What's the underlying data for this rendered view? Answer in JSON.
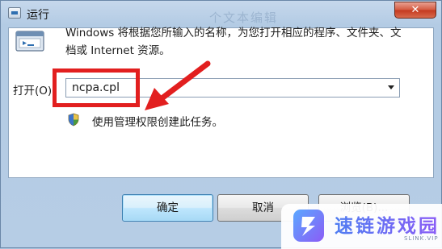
{
  "window": {
    "title": "运行",
    "close_glyph": "✕",
    "background_title_text": "个文本编辑"
  },
  "dialog": {
    "description": "Windows 将根据您所输入的名称，为您打开相应的程序、文件夹、文档或 Internet 资源。",
    "open_label": "打开(O):",
    "command_value": "ncpa.cpl",
    "admin_note": "使用管理权限创建此任务。"
  },
  "buttons": {
    "ok": "确定",
    "cancel": "取消",
    "browse": "浏览(B)..."
  },
  "annotation": {
    "highlight_color": "#e21f1f"
  },
  "watermark": {
    "name": "速链游戏园",
    "sub": "SLINK.VIP"
  },
  "colors": {
    "window_frame": "#b6cde5",
    "close_button": "#c4391f",
    "default_button_border": "#3c7fb1"
  }
}
